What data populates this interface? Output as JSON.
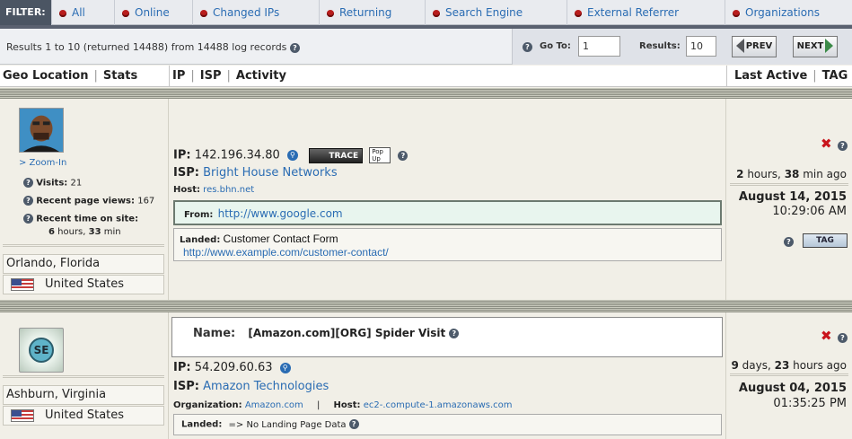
{
  "filterbar": {
    "label": "FILTER:",
    "tabs": [
      "All",
      "Online",
      "Changed IPs",
      "Returning",
      "Search Engine",
      "External Referrer",
      "Organizations"
    ]
  },
  "results": {
    "summary": "Results 1 to 10 (returned 14488) from 14488 log records",
    "goto_label": "Go To:",
    "goto_value": "1",
    "results_label": "Results:",
    "results_value": "10",
    "prev_label": "PREV",
    "next_label": "NEXT"
  },
  "columns": {
    "geo": "Geo Location",
    "stats": "Stats",
    "ip": "IP",
    "isp": "ISP",
    "activity": "Activity",
    "last_active": "Last Active",
    "tag": "TAG"
  },
  "records": [
    {
      "zoom": "> Zoom-In",
      "visits_label": "Visits:",
      "visits": "21",
      "pageviews_label": "Recent page views:",
      "pageviews": "167",
      "time_label": "Recent time on site:",
      "time_hours": "6",
      "time_hours_unit": "hours,",
      "time_min": "33",
      "time_min_unit": "min",
      "city": "Orlando, Florida",
      "country": "United States",
      "ip_label": "IP:",
      "ip": "142.196.34.80",
      "trace_label": "TRACE",
      "popup_label": "Pop Up",
      "isp_label": "ISP:",
      "isp": "Bright House Networks",
      "host_label": "Host:",
      "host": "res.bhn.net",
      "from_label": "From:",
      "from_url": "http://www.google.com",
      "landed_label": "Landed:",
      "landed_title": "Customer Contact Form",
      "landed_url": "http://www.example.com/customer-contact/",
      "ago_a": "2",
      "ago_a_unit": "hours,",
      "ago_b": "38",
      "ago_b_unit": "min ago",
      "date": "August 14, 2015",
      "time": "10:29:06 AM",
      "tag_label": "TAG"
    },
    {
      "avatar_text": "SE",
      "city": "Ashburn, Virginia",
      "country": "United States",
      "name_label": "Name:",
      "name": "[Amazon.com][ORG] Spider Visit",
      "ip_label": "IP:",
      "ip": "54.209.60.63",
      "isp_label": "ISP:",
      "isp": "Amazon Technologies",
      "org_label": "Organization:",
      "org": "Amazon.com",
      "org_sep": "|",
      "host_label": "Host:",
      "host": "ec2-.compute-1.amazonaws.com",
      "landed_label": "Landed:",
      "landed_text": "=> No Landing Page Data",
      "ago_a": "9",
      "ago_a_unit": "days,",
      "ago_b": "23",
      "ago_b_unit": "hours ago",
      "date": "August 04, 2015",
      "time": "01:35:25 PM"
    }
  ]
}
